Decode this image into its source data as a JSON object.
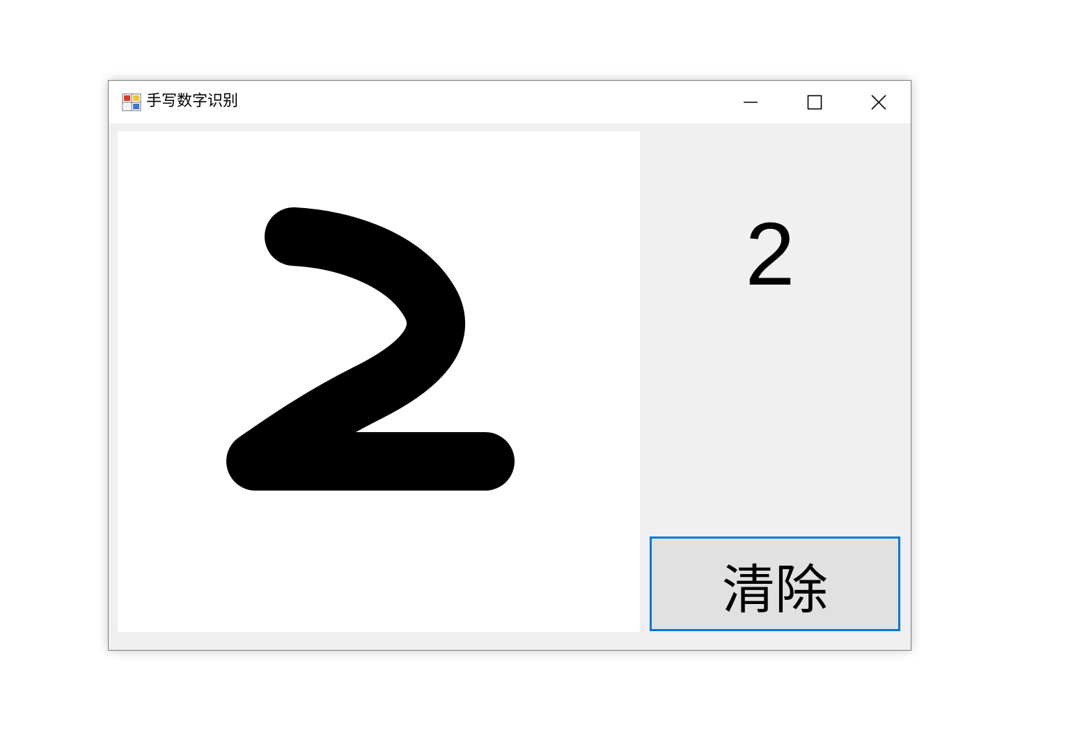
{
  "window": {
    "title": "手写数字识别",
    "icon": "winforms-app-icon",
    "controls": {
      "minimize_icon": "minimize-icon",
      "maximize_icon": "maximize-icon",
      "close_icon": "close-icon"
    }
  },
  "canvas": {
    "drawn_glyph": "2",
    "stroke_color": "#000000",
    "background_color": "#ffffff"
  },
  "result": {
    "value": "2"
  },
  "actions": {
    "clear_label": "清除"
  },
  "colors": {
    "accent_border": "#0078d7",
    "button_background": "#e1e1e1",
    "panel_background": "#f0f0f0"
  }
}
